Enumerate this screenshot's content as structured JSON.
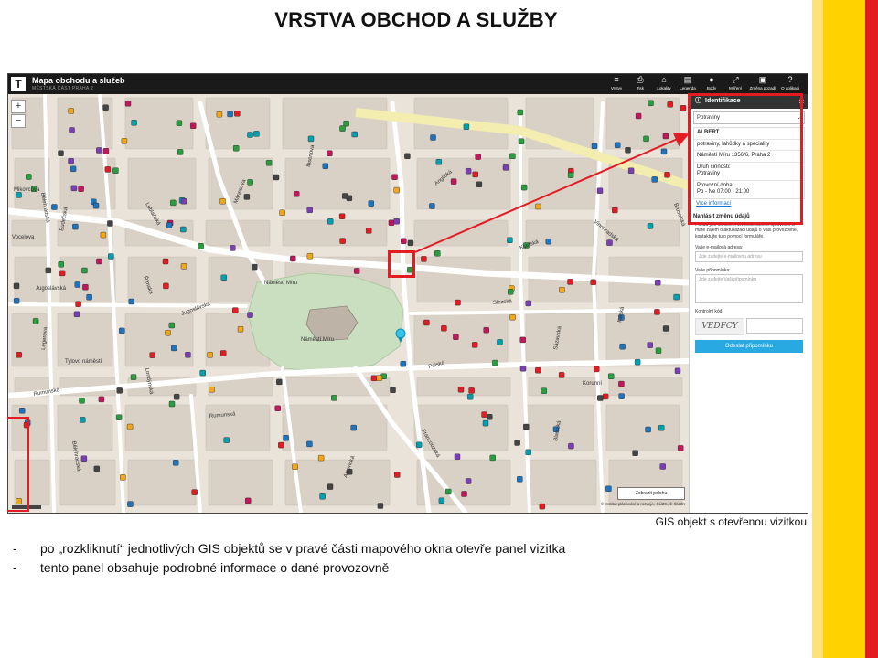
{
  "slide": {
    "title": "VRSTVA OBCHOD A SLUŽBY",
    "caption": "GIS objekt s otevřenou vizitkou",
    "bullets": [
      "po „rozkliknutí“ jednotlivých GIS objektů se v pravé části mapového okna otevře panel vizitka",
      "tento panel obsahuje podrobné informace o dané provozovně"
    ]
  },
  "app": {
    "title": "Mapa obchodu a služeb",
    "subtitle": "MĚSTSKÁ ČÁST PRAHA 2",
    "toolbar": [
      {
        "label": "Vrstvy",
        "icon": "layers-icon",
        "glyph": "≡"
      },
      {
        "label": "Tisk",
        "icon": "print-icon",
        "glyph": "⎙"
      },
      {
        "label": "Lokality",
        "icon": "location-icon",
        "glyph": "⌂"
      },
      {
        "label": "Legenda",
        "icon": "legend-icon",
        "glyph": "▤"
      },
      {
        "label": "Body",
        "icon": "points-icon",
        "glyph": "●"
      },
      {
        "label": "Měření",
        "icon": "measure-icon",
        "glyph": "⤢"
      },
      {
        "label": "Změna pozadí",
        "icon": "background-icon",
        "glyph": "▣"
      },
      {
        "label": "O aplikaci",
        "icon": "help-icon",
        "glyph": "?"
      }
    ],
    "zoom_in": "+",
    "zoom_out": "−",
    "legend_button": "Zobrazit polohu",
    "attribution": "© Institut plánování a rozvoje, ČÚZK, © ČÚZK"
  },
  "map": {
    "street_labels": [
      "Mikovcova",
      "Vocelova",
      "Bělehradská",
      "Jugoslávská",
      "Legerova",
      "Rumunská",
      "Lublaňská",
      "Náměstí Míru",
      "Bělehradská",
      "Tylovo náměstí",
      "Jugoslávská",
      "Rumunská",
      "Londýnská",
      "Sázavská",
      "Slezská",
      "Korunní",
      "Francouzská",
      "Americká",
      "Náměstí Míru",
      "Anglická",
      "Vinohradská",
      "Bruselská",
      "Italská",
      "Blanická",
      "Polská",
      "Kladská",
      "Římská",
      "Ibsenova",
      "Mánesova",
      "Budečská"
    ]
  },
  "panel": {
    "header": "Identifikace",
    "header_icon": "info-icon",
    "close": "×",
    "select_value": "Potraviny",
    "business_name": "ALBERT",
    "business_desc": "potraviny, lahůdky a speciality",
    "address": "Náměstí Míru 1356/6, Praha 2",
    "activity_label": "Druh činnosti:",
    "activity_value": "Potraviny",
    "hours_label": "Provozní doba:",
    "hours_value": "Po - Ne 07:00 - 21:00",
    "more_info": "Více informací",
    "report_title": "Nahlásit změnu údajů",
    "report_text": "Pokud jste držitelem živnostenského oprávnění a máte zájem o aktualizaci údajů o Vaší provozovně, kontaktujte tuto pomocí formuláře.",
    "email_label": "Vaše e-mailová adresa:",
    "email_placeholder": "Zde zadejte e-mailovou adresu",
    "note_label": "Vaše připomínka:",
    "note_placeholder": "Zde zadejte Vaši připomínku",
    "captcha_label": "Kontrolní kód:",
    "captcha_text": "VEDFCY",
    "submit": "Odeslat připomínku"
  },
  "colors": {
    "accent_red": "#e31b23",
    "accent_yellow": "#ffd200",
    "button_blue": "#29a9e1"
  }
}
